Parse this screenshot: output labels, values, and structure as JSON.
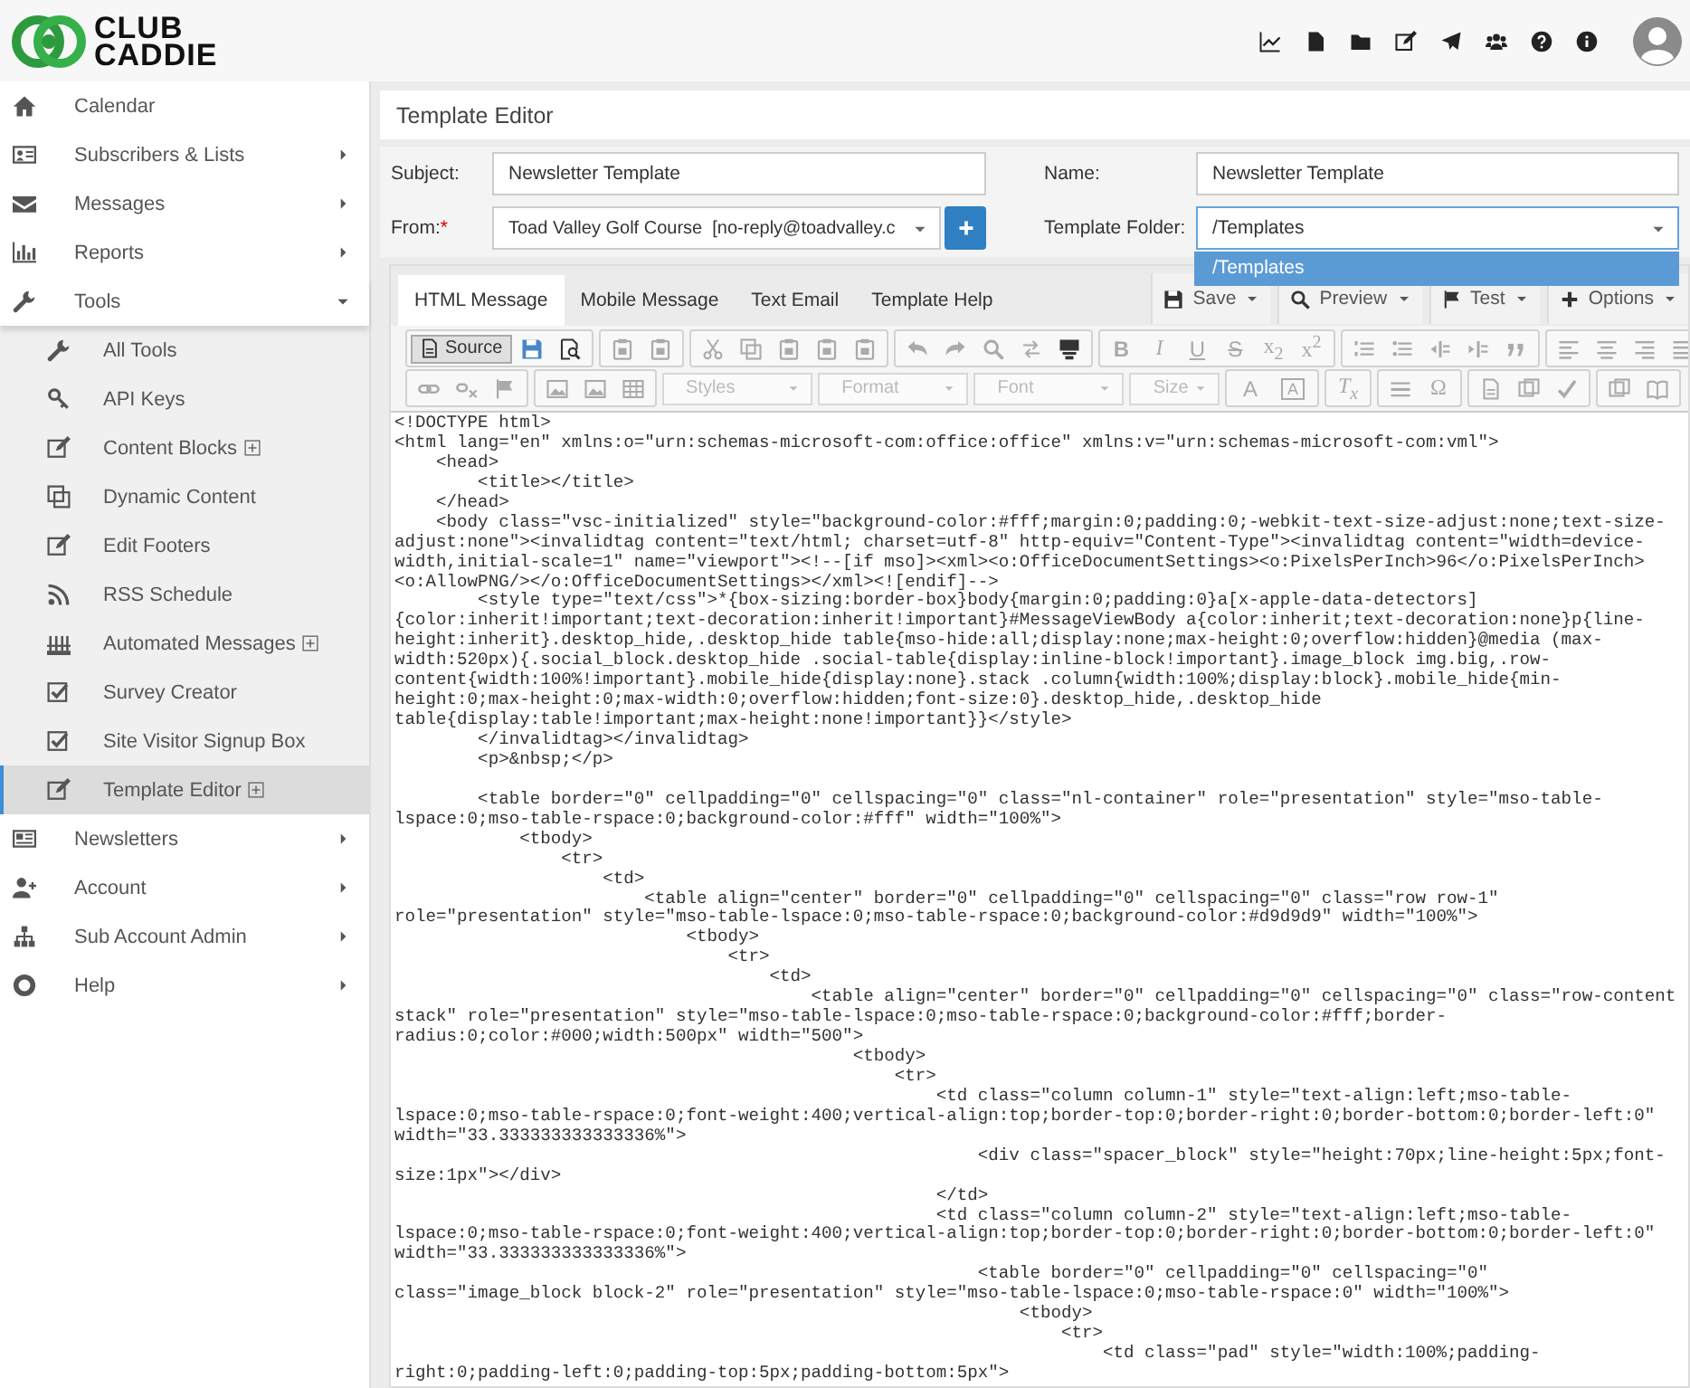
{
  "header": {
    "logo": {
      "line_1": "CLUB",
      "line_2": "CADDIE"
    }
  },
  "sidebar": {
    "items": [
      {
        "label": "Calendar",
        "expandable": false,
        "expanded": false
      },
      {
        "label": "Subscribers & Lists",
        "expandable": true,
        "expanded": false
      },
      {
        "label": "Messages",
        "expandable": true,
        "expanded": false
      },
      {
        "label": "Reports",
        "expandable": true,
        "expanded": false
      },
      {
        "label": "Tools",
        "expandable": true,
        "expanded": true,
        "children": [
          {
            "label": "All Tools",
            "has_plus": false,
            "selected": false
          },
          {
            "label": "API Keys",
            "has_plus": false,
            "selected": false
          },
          {
            "label": "Content Blocks",
            "has_plus": true,
            "selected": false
          },
          {
            "label": "Dynamic Content",
            "has_plus": false,
            "selected": false
          },
          {
            "label": "Edit Footers",
            "has_plus": false,
            "selected": false
          },
          {
            "label": "RSS Schedule",
            "has_plus": false,
            "selected": false
          },
          {
            "label": "Automated Messages",
            "has_plus": true,
            "selected": false
          },
          {
            "label": "Survey Creator",
            "has_plus": false,
            "selected": false
          },
          {
            "label": "Site Visitor Signup Box",
            "has_plus": false,
            "selected": false
          },
          {
            "label": "Template Editor",
            "has_plus": true,
            "selected": true
          }
        ]
      },
      {
        "label": "Newsletters",
        "expandable": true,
        "expanded": false
      },
      {
        "label": "Account",
        "expandable": true,
        "expanded": false
      },
      {
        "label": "Sub Account Admin",
        "expandable": true,
        "expanded": false
      },
      {
        "label": "Help",
        "expandable": true,
        "expanded": false
      }
    ]
  },
  "page_title": "Template Editor",
  "form": {
    "subject": {
      "label": "Subject:",
      "value": "Newsletter Template"
    },
    "name": {
      "label": "Name:",
      "value": "Newsletter Template"
    },
    "from": {
      "label": "From:",
      "required_mark": "*",
      "value": "Toad Valley Golf Course  [no-reply@toadvalley.c"
    },
    "template_folder": {
      "label": "Template Folder:",
      "value": "/Templates",
      "open": true,
      "options": [
        {
          "label": "/Templates",
          "selected": true
        }
      ]
    }
  },
  "editor": {
    "tabs": [
      {
        "label": "HTML Message",
        "selected": true
      },
      {
        "label": "Mobile Message",
        "selected": false
      },
      {
        "label": "Text Email",
        "selected": false
      },
      {
        "label": "Template Help",
        "selected": false
      }
    ],
    "actions": [
      "Save",
      "Preview",
      "Test",
      "Options"
    ],
    "toolbar": {
      "source": {
        "label": "Source",
        "active": true
      },
      "style_glyphs": [
        "B",
        "I",
        "U",
        "S",
        "x$_{2}$",
        "x$^{2}$"
      ],
      "combos": [
        "Styles",
        "Format",
        "Font",
        "Size"
      ],
      "color_glyphs": [
        "A",
        "A"
      ],
      "remove_format": "T$_{x}$",
      "special_char": "Ω"
    },
    "source_lines": [
      {
        "text": "<!DOCTYPE html>"
      },
      {
        "text": "<html lang=\"en\" xmlns:o=\"urn:schemas-microsoft-com:office:office\" xmlns:v=\"urn:schemas-microsoft-com:vml\">"
      },
      {
        "text": "    <head>"
      },
      {
        "text": "        <title></title>"
      },
      {
        "text": "    </head>"
      },
      {
        "text": "    <body class=\"vsc-initialized\" style=\"background-color:#fff;margin:0;padding:0;-webkit-text-size-adjust:none;text-size-"
      },
      {
        "text": "adjust:none\"><invalidtag content=\"text/html; charset=utf-8\" http-equiv=\"Content-Type\"><invalidtag content=\"width=device-"
      },
      {
        "text": "width,initial-scale=1\" name=\"viewport\"><!--[if mso]><xml><o:OfficeDocumentSettings><o:PixelsPerInch>96</o:PixelsPerInch>"
      },
      {
        "text": "<o:AllowPNG/></o:OfficeDocumentSettings></xml><![endif]-->"
      },
      {
        "text": "        <style type=\"text/css\">*{box-sizing:border-box}body{margin:0;padding:0}a[x-apple-data-detectors]"
      },
      {
        "text": "{color:inherit!important;text-decoration:inherit!important}#MessageViewBody a{color:inherit;text-decoration:none}p{line-"
      },
      {
        "text": "height:inherit}.desktop_hide,.desktop_hide table{mso-hide:all;display:none;max-height:0;overflow:hidden}@media (max-"
      },
      {
        "text": "width:520px){.social_block.desktop_hide .social-table{display:inline-block!important}.image_block img.big,.row-"
      },
      {
        "text": "content{width:100%!important}.mobile_hide{display:none}.stack .column{width:100%;display:block}.mobile_hide{min-"
      },
      {
        "text": "height:0;max-height:0;max-width:0;overflow:hidden;font-size:0}.desktop_hide,.desktop_hide"
      },
      {
        "text": "table{display:table!important;max-height:none!important}}</style>"
      },
      {
        "text": "        </invalidtag></invalidtag>"
      },
      {
        "text": "        <p>&nbsp;</p>"
      },
      {
        "text": "        <table border=\"0\" cellpadding=\"0\" cellspacing=\"0\" class=\"nl-container\" role=\"presentation\" style=\"mso-table-",
        "blank_before": true
      },
      {
        "text": "lspace:0;mso-table-rspace:0;background-color:#fff\" width=\"100%\">"
      },
      {
        "text": "            <tbody>"
      },
      {
        "text": "                <tr>"
      },
      {
        "text": "                    <td>"
      },
      {
        "text": "                        <table align=\"center\" border=\"0\" cellpadding=\"0\" cellspacing=\"0\" class=\"row row-1\""
      },
      {
        "text": "role=\"presentation\" style=\"mso-table-lspace:0;mso-table-rspace:0;background-color:#d9d9d9\" width=\"100%\">"
      },
      {
        "text": "                            <tbody>"
      },
      {
        "text": "                                <tr>"
      },
      {
        "text": "                                    <td>"
      },
      {
        "text": "                                        <table align=\"center\" border=\"0\" cellpadding=\"0\" cellspacing=\"0\" class=\"row-content"
      },
      {
        "text": "stack\" role=\"presentation\" style=\"mso-table-lspace:0;mso-table-rspace:0;background-color:#fff;border-"
      },
      {
        "text": "radius:0;color:#000;width:500px\" width=\"500\">"
      },
      {
        "text": "                                            <tbody>"
      },
      {
        "text": "                                                <tr>"
      },
      {
        "text": "                                                    <td class=\"column column-1\" style=\"text-align:left;mso-table-"
      },
      {
        "text": "lspace:0;mso-table-rspace:0;font-weight:400;vertical-align:top;border-top:0;border-right:0;border-bottom:0;border-left:0\""
      },
      {
        "text": "width=\"33.333333333333336%\">"
      },
      {
        "text": "                                                        <div class=\"spacer_block\" style=\"height:70px;line-height:5px;font-"
      },
      {
        "text": "size:1px\"></div>"
      },
      {
        "text": "                                                    </td>"
      },
      {
        "text": "                                                    <td class=\"column column-2\" style=\"text-align:left;mso-table-"
      },
      {
        "text": "lspace:0;mso-table-rspace:0;font-weight:400;vertical-align:top;border-top:0;border-right:0;border-bottom:0;border-left:0\""
      },
      {
        "text": "width=\"33.333333333333336%\">"
      },
      {
        "text": "                                                        <table border=\"0\" cellpadding=\"0\" cellspacing=\"0\""
      },
      {
        "text": "class=\"image_block block-2\" role=\"presentation\" style=\"mso-table-lspace:0;mso-table-rspace:0\" width=\"100%\">"
      },
      {
        "text": "                                                            <tbody>"
      },
      {
        "text": "                                                                <tr>"
      },
      {
        "text": "                                                                    <td class=\"pad\" style=\"width:100%;padding-"
      },
      {
        "text": "right:0;padding-left:0;padding-top:5px;padding-bottom:5px\">"
      }
    ]
  }
}
